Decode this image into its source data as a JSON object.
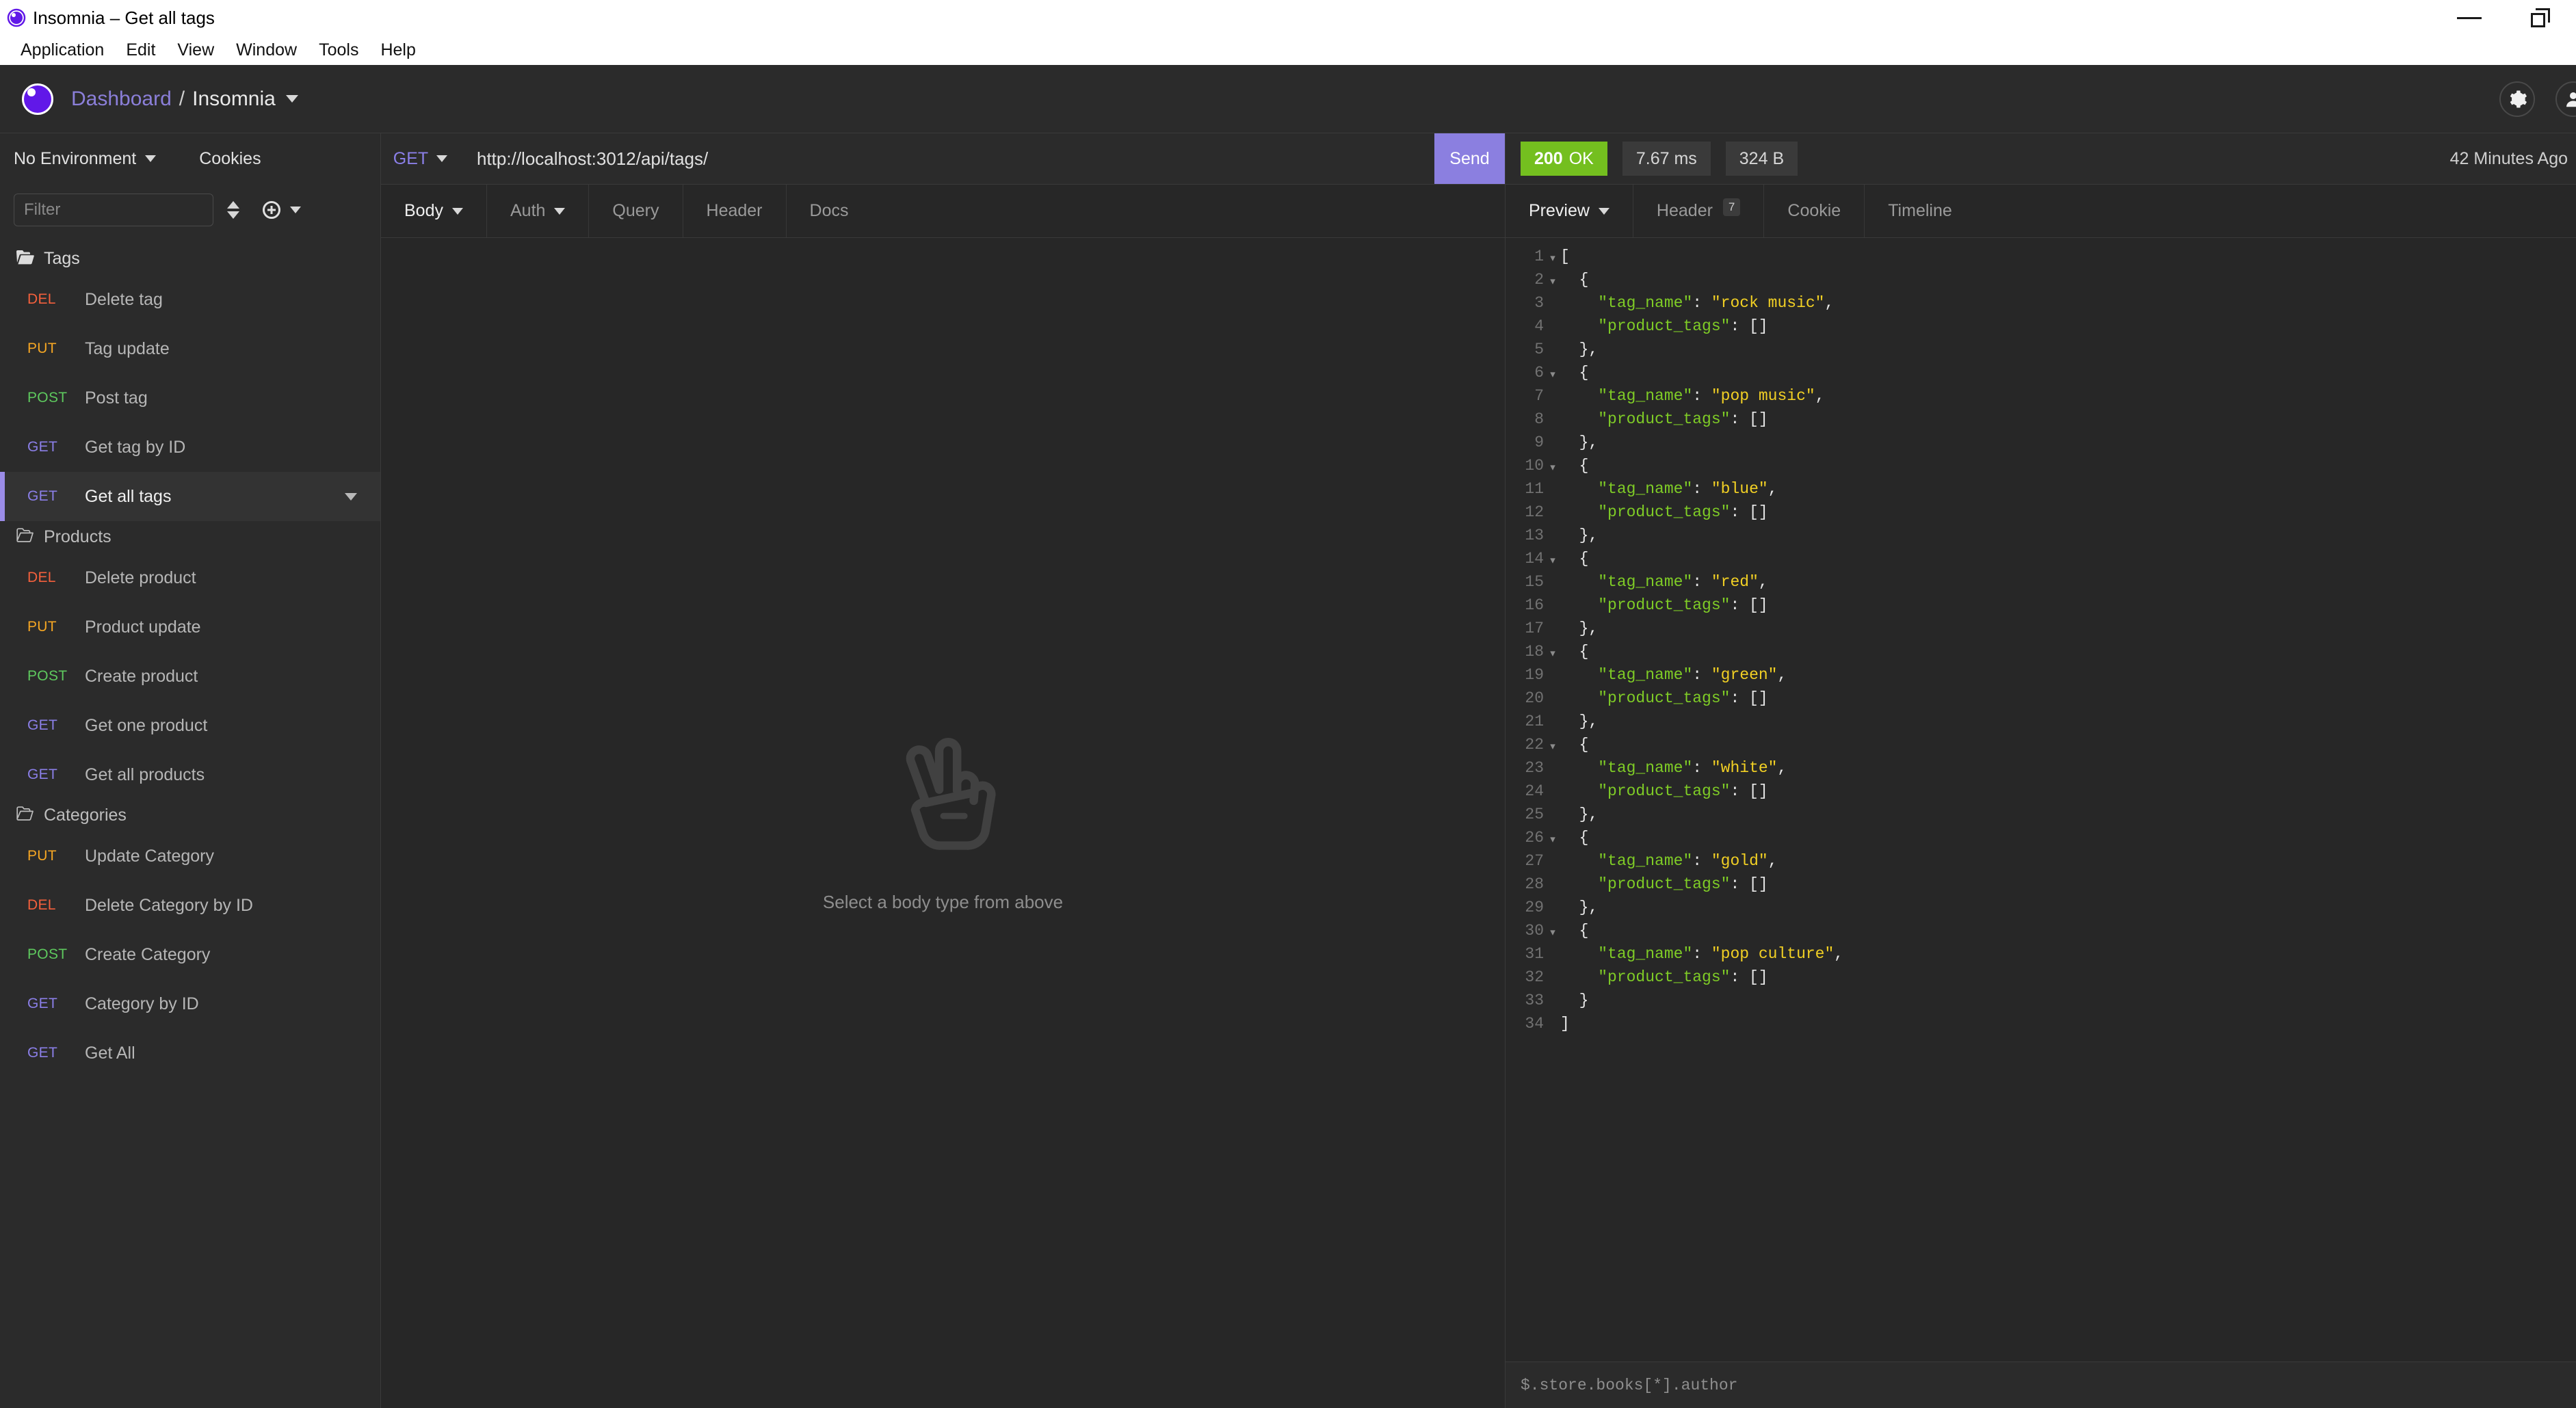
{
  "window": {
    "title": "Insomnia – Get all tags",
    "app_icon": "insomnia-logo-icon",
    "minimize": "minimize-icon",
    "maximize": "restore-icon"
  },
  "menubar": {
    "items": [
      {
        "label": "Application"
      },
      {
        "label": "Edit"
      },
      {
        "label": "View"
      },
      {
        "label": "Window"
      },
      {
        "label": "Tools"
      },
      {
        "label": "Help"
      }
    ]
  },
  "header": {
    "logo": "insomnia-logo-icon",
    "breadcrumb_root": "Dashboard",
    "breadcrumb_sep": "/",
    "breadcrumb_current": "Insomnia",
    "workspace_caret": "chevron-down-icon",
    "settings_icon": "gear-icon",
    "account_icon": "account-icon"
  },
  "sidebar": {
    "environment_label": "No Environment",
    "environment_caret": "chevron-down-icon",
    "cookies_label": "Cookies",
    "filter_placeholder": "Filter",
    "filter_value": "",
    "sort_icon": "sort-icon",
    "add_icon": "plus-circle-icon",
    "add_caret": "chevron-down-icon",
    "groups": [
      {
        "name": "Tags",
        "icon": "folder-open-icon",
        "requests": [
          {
            "method": "DEL",
            "name": "Delete tag",
            "selected": false
          },
          {
            "method": "PUT",
            "name": "Tag update",
            "selected": false
          },
          {
            "method": "POST",
            "name": "Post tag",
            "selected": false
          },
          {
            "method": "GET",
            "name": "Get tag by ID",
            "selected": false
          },
          {
            "method": "GET",
            "name": "Get all tags",
            "selected": true
          }
        ]
      },
      {
        "name": "Products",
        "icon": "folder-outline-icon",
        "requests": [
          {
            "method": "DEL",
            "name": "Delete product",
            "selected": false
          },
          {
            "method": "PUT",
            "name": "Product update",
            "selected": false
          },
          {
            "method": "POST",
            "name": "Create product",
            "selected": false
          },
          {
            "method": "GET",
            "name": "Get one product",
            "selected": false
          },
          {
            "method": "GET",
            "name": "Get all products",
            "selected": false
          }
        ]
      },
      {
        "name": "Categories",
        "icon": "folder-outline-icon",
        "requests": [
          {
            "method": "PUT",
            "name": "Update Category",
            "selected": false
          },
          {
            "method": "DEL",
            "name": "Delete Category by ID",
            "selected": false
          },
          {
            "method": "POST",
            "name": "Create Category",
            "selected": false
          },
          {
            "method": "GET",
            "name": "Category by ID",
            "selected": false
          },
          {
            "method": "GET",
            "name": "Get All",
            "selected": false
          }
        ]
      }
    ]
  },
  "request": {
    "method": "GET",
    "method_caret": "chevron-down-icon",
    "url": "http://localhost:3012/api/tags/",
    "send_label": "Send",
    "tabs": [
      {
        "label": "Body",
        "active": true,
        "caret": true
      },
      {
        "label": "Auth",
        "active": false,
        "caret": true
      },
      {
        "label": "Query",
        "active": false,
        "caret": false
      },
      {
        "label": "Header",
        "active": false,
        "caret": false
      },
      {
        "label": "Docs",
        "active": false,
        "caret": false
      }
    ],
    "empty_icon": "peace-hand-icon",
    "empty_text": "Select a body type from above"
  },
  "response": {
    "status_code": "200",
    "status_text": "OK",
    "time": "7.67 ms",
    "size": "324 B",
    "timestamp": "42 Minutes Ago",
    "tabs": [
      {
        "label": "Preview",
        "active": true,
        "caret": true,
        "badge": ""
      },
      {
        "label": "Header",
        "active": false,
        "caret": false,
        "badge": "7"
      },
      {
        "label": "Cookie",
        "active": false,
        "caret": false,
        "badge": ""
      },
      {
        "label": "Timeline",
        "active": false,
        "caret": false,
        "badge": ""
      }
    ],
    "jsonpath_placeholder": "$.store.books[*].author",
    "jsonpath_value": "",
    "body_lines": [
      {
        "n": 1,
        "fold": true,
        "indent": 0,
        "parts": [
          {
            "t": "p",
            "v": "["
          }
        ]
      },
      {
        "n": 2,
        "fold": true,
        "indent": 1,
        "parts": [
          {
            "t": "p",
            "v": "{"
          }
        ]
      },
      {
        "n": 3,
        "fold": false,
        "indent": 2,
        "parts": [
          {
            "t": "k",
            "v": "\"tag_name\""
          },
          {
            "t": "p",
            "v": ": "
          },
          {
            "t": "s",
            "v": "\"rock music\""
          },
          {
            "t": "p",
            "v": ","
          }
        ]
      },
      {
        "n": 4,
        "fold": false,
        "indent": 2,
        "parts": [
          {
            "t": "k",
            "v": "\"product_tags\""
          },
          {
            "t": "p",
            "v": ": []"
          }
        ]
      },
      {
        "n": 5,
        "fold": false,
        "indent": 1,
        "parts": [
          {
            "t": "p",
            "v": "},"
          }
        ]
      },
      {
        "n": 6,
        "fold": true,
        "indent": 1,
        "parts": [
          {
            "t": "p",
            "v": "{"
          }
        ]
      },
      {
        "n": 7,
        "fold": false,
        "indent": 2,
        "parts": [
          {
            "t": "k",
            "v": "\"tag_name\""
          },
          {
            "t": "p",
            "v": ": "
          },
          {
            "t": "s",
            "v": "\"pop music\""
          },
          {
            "t": "p",
            "v": ","
          }
        ]
      },
      {
        "n": 8,
        "fold": false,
        "indent": 2,
        "parts": [
          {
            "t": "k",
            "v": "\"product_tags\""
          },
          {
            "t": "p",
            "v": ": []"
          }
        ]
      },
      {
        "n": 9,
        "fold": false,
        "indent": 1,
        "parts": [
          {
            "t": "p",
            "v": "},"
          }
        ]
      },
      {
        "n": 10,
        "fold": true,
        "indent": 1,
        "parts": [
          {
            "t": "p",
            "v": "{"
          }
        ]
      },
      {
        "n": 11,
        "fold": false,
        "indent": 2,
        "parts": [
          {
            "t": "k",
            "v": "\"tag_name\""
          },
          {
            "t": "p",
            "v": ": "
          },
          {
            "t": "s",
            "v": "\"blue\""
          },
          {
            "t": "p",
            "v": ","
          }
        ]
      },
      {
        "n": 12,
        "fold": false,
        "indent": 2,
        "parts": [
          {
            "t": "k",
            "v": "\"product_tags\""
          },
          {
            "t": "p",
            "v": ": []"
          }
        ]
      },
      {
        "n": 13,
        "fold": false,
        "indent": 1,
        "parts": [
          {
            "t": "p",
            "v": "},"
          }
        ]
      },
      {
        "n": 14,
        "fold": true,
        "indent": 1,
        "parts": [
          {
            "t": "p",
            "v": "{"
          }
        ]
      },
      {
        "n": 15,
        "fold": false,
        "indent": 2,
        "parts": [
          {
            "t": "k",
            "v": "\"tag_name\""
          },
          {
            "t": "p",
            "v": ": "
          },
          {
            "t": "s",
            "v": "\"red\""
          },
          {
            "t": "p",
            "v": ","
          }
        ]
      },
      {
        "n": 16,
        "fold": false,
        "indent": 2,
        "parts": [
          {
            "t": "k",
            "v": "\"product_tags\""
          },
          {
            "t": "p",
            "v": ": []"
          }
        ]
      },
      {
        "n": 17,
        "fold": false,
        "indent": 1,
        "parts": [
          {
            "t": "p",
            "v": "},"
          }
        ]
      },
      {
        "n": 18,
        "fold": true,
        "indent": 1,
        "parts": [
          {
            "t": "p",
            "v": "{"
          }
        ]
      },
      {
        "n": 19,
        "fold": false,
        "indent": 2,
        "parts": [
          {
            "t": "k",
            "v": "\"tag_name\""
          },
          {
            "t": "p",
            "v": ": "
          },
          {
            "t": "s",
            "v": "\"green\""
          },
          {
            "t": "p",
            "v": ","
          }
        ]
      },
      {
        "n": 20,
        "fold": false,
        "indent": 2,
        "parts": [
          {
            "t": "k",
            "v": "\"product_tags\""
          },
          {
            "t": "p",
            "v": ": []"
          }
        ]
      },
      {
        "n": 21,
        "fold": false,
        "indent": 1,
        "parts": [
          {
            "t": "p",
            "v": "},"
          }
        ]
      },
      {
        "n": 22,
        "fold": true,
        "indent": 1,
        "parts": [
          {
            "t": "p",
            "v": "{"
          }
        ]
      },
      {
        "n": 23,
        "fold": false,
        "indent": 2,
        "parts": [
          {
            "t": "k",
            "v": "\"tag_name\""
          },
          {
            "t": "p",
            "v": ": "
          },
          {
            "t": "s",
            "v": "\"white\""
          },
          {
            "t": "p",
            "v": ","
          }
        ]
      },
      {
        "n": 24,
        "fold": false,
        "indent": 2,
        "parts": [
          {
            "t": "k",
            "v": "\"product_tags\""
          },
          {
            "t": "p",
            "v": ": []"
          }
        ]
      },
      {
        "n": 25,
        "fold": false,
        "indent": 1,
        "parts": [
          {
            "t": "p",
            "v": "},"
          }
        ]
      },
      {
        "n": 26,
        "fold": true,
        "indent": 1,
        "parts": [
          {
            "t": "p",
            "v": "{"
          }
        ]
      },
      {
        "n": 27,
        "fold": false,
        "indent": 2,
        "parts": [
          {
            "t": "k",
            "v": "\"tag_name\""
          },
          {
            "t": "p",
            "v": ": "
          },
          {
            "t": "s",
            "v": "\"gold\""
          },
          {
            "t": "p",
            "v": ","
          }
        ]
      },
      {
        "n": 28,
        "fold": false,
        "indent": 2,
        "parts": [
          {
            "t": "k",
            "v": "\"product_tags\""
          },
          {
            "t": "p",
            "v": ": []"
          }
        ]
      },
      {
        "n": 29,
        "fold": false,
        "indent": 1,
        "parts": [
          {
            "t": "p",
            "v": "},"
          }
        ]
      },
      {
        "n": 30,
        "fold": true,
        "indent": 1,
        "parts": [
          {
            "t": "p",
            "v": "{"
          }
        ]
      },
      {
        "n": 31,
        "fold": false,
        "indent": 2,
        "parts": [
          {
            "t": "k",
            "v": "\"tag_name\""
          },
          {
            "t": "p",
            "v": ": "
          },
          {
            "t": "s",
            "v": "\"pop culture\""
          },
          {
            "t": "p",
            "v": ","
          }
        ]
      },
      {
        "n": 32,
        "fold": false,
        "indent": 2,
        "parts": [
          {
            "t": "k",
            "v": "\"product_tags\""
          },
          {
            "t": "p",
            "v": ": []"
          }
        ]
      },
      {
        "n": 33,
        "fold": false,
        "indent": 1,
        "parts": [
          {
            "t": "p",
            "v": "}"
          }
        ]
      },
      {
        "n": 34,
        "fold": false,
        "indent": 0,
        "parts": [
          {
            "t": "p",
            "v": "]"
          }
        ]
      }
    ]
  },
  "colors": {
    "accent_purple": "#8b7fe8",
    "send_purple": "#8b7fe0",
    "status_green": "#74bf1f",
    "method_get": "#8b7fe8",
    "method_post": "#5ec95e",
    "method_put": "#f5a623",
    "method_del": "#f4603c",
    "json_key_green": "#7fcc26",
    "json_string_yellow": "#f2d024",
    "bg_main": "#272727",
    "bg_panel": "#2b2b2b"
  }
}
